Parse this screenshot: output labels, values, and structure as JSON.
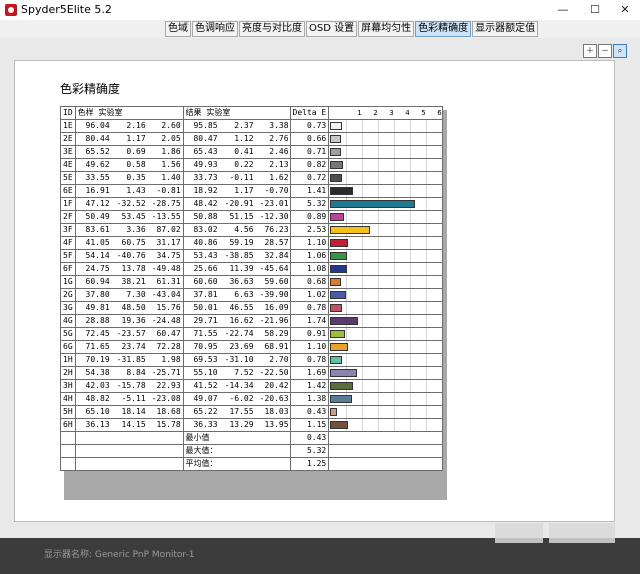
{
  "window": {
    "title": "Spyder5Elite 5.2",
    "min": "—",
    "max": "☐",
    "close": "✕"
  },
  "tabs": [
    "色域",
    "色调响应",
    "亮度与对比度",
    "OSD 设置",
    "屏幕均匀性",
    "色彩精确度",
    "显示器额定值"
  ],
  "active_tab": 5,
  "zoom_icons": [
    "zoom-in-icon",
    "zoom-out-icon",
    "zoom-fit-icon"
  ],
  "report": {
    "title": "色彩精确度"
  },
  "table": {
    "headers": {
      "id": "ID",
      "ref": "色样 实验室",
      "res": "结果 实验室",
      "de": "Delta E"
    },
    "scale": [
      "1",
      "2",
      "3",
      "4",
      "5",
      "6",
      "7"
    ],
    "rows": [
      {
        "id": "1E",
        "ref": [
          "96.04",
          "2.16",
          "2.60"
        ],
        "res": [
          "95.85",
          "2.37",
          "3.38"
        ],
        "de": "0.73",
        "color": "#f2f2f2"
      },
      {
        "id": "2E",
        "ref": [
          "80.44",
          "1.17",
          "2.05"
        ],
        "res": [
          "80.47",
          "1.12",
          "2.76"
        ],
        "de": "0.66",
        "color": "#c8c8c8"
      },
      {
        "id": "3E",
        "ref": [
          "65.52",
          "0.69",
          "1.86"
        ],
        "res": [
          "65.43",
          "0.41",
          "2.46"
        ],
        "de": "0.71",
        "color": "#a0a0a0"
      },
      {
        "id": "4E",
        "ref": [
          "49.62",
          "0.58",
          "1.56"
        ],
        "res": [
          "49.93",
          "0.22",
          "2.13"
        ],
        "de": "0.82",
        "color": "#777777"
      },
      {
        "id": "5E",
        "ref": [
          "33.55",
          "0.35",
          "1.40"
        ],
        "res": [
          "33.73",
          "-0.11",
          "1.62"
        ],
        "de": "0.72",
        "color": "#4e4e4e"
      },
      {
        "id": "6E",
        "ref": [
          "16.91",
          "1.43",
          "-0.81"
        ],
        "res": [
          "18.92",
          "1.17",
          "-0.70"
        ],
        "de": "1.41",
        "color": "#2b2b2b"
      },
      {
        "id": "1F",
        "ref": [
          "47.12",
          "-32.52",
          "-28.75"
        ],
        "res": [
          "48.42",
          "-20.91",
          "-23.01"
        ],
        "de": "5.32",
        "color": "#1e7a92"
      },
      {
        "id": "2F",
        "ref": [
          "50.49",
          "53.45",
          "-13.55"
        ],
        "res": [
          "50.88",
          "51.15",
          "-12.30"
        ],
        "de": "0.89",
        "color": "#b9449a"
      },
      {
        "id": "3F",
        "ref": [
          "83.61",
          "3.36",
          "87.02"
        ],
        "res": [
          "83.02",
          "4.56",
          "76.23"
        ],
        "de": "2.53",
        "color": "#f2c21a"
      },
      {
        "id": "4F",
        "ref": [
          "41.05",
          "60.75",
          "31.17"
        ],
        "res": [
          "40.86",
          "59.19",
          "28.57"
        ],
        "de": "1.10",
        "color": "#bf2036"
      },
      {
        "id": "5F",
        "ref": [
          "54.14",
          "-40.76",
          "34.75"
        ],
        "res": [
          "53.43",
          "-38.85",
          "32.84"
        ],
        "de": "1.06",
        "color": "#3c9449"
      },
      {
        "id": "6F",
        "ref": [
          "24.75",
          "13.78",
          "-49.48"
        ],
        "res": [
          "25.66",
          "11.39",
          "-45.64"
        ],
        "de": "1.08",
        "color": "#25368e"
      },
      {
        "id": "1G",
        "ref": [
          "60.94",
          "38.21",
          "61.31"
        ],
        "res": [
          "60.60",
          "36.63",
          "59.60"
        ],
        "de": "0.68",
        "color": "#e07a25"
      },
      {
        "id": "2G",
        "ref": [
          "37.80",
          "7.30",
          "-43.04"
        ],
        "res": [
          "37.81",
          "6.63",
          "-39.90"
        ],
        "de": "1.02",
        "color": "#4a5aa8"
      },
      {
        "id": "3G",
        "ref": [
          "49.81",
          "48.50",
          "15.76"
        ],
        "res": [
          "50.01",
          "46.55",
          "16.09"
        ],
        "de": "0.78",
        "color": "#c25461"
      },
      {
        "id": "4G",
        "ref": [
          "28.88",
          "19.36",
          "-24.48"
        ],
        "res": [
          "29.71",
          "16.62",
          "-21.96"
        ],
        "de": "1.74",
        "color": "#5b3a6e"
      },
      {
        "id": "5G",
        "ref": [
          "72.45",
          "-23.57",
          "60.47"
        ],
        "res": [
          "71.55",
          "-22.74",
          "58.29"
        ],
        "de": "0.91",
        "color": "#9ebc3c"
      },
      {
        "id": "6G",
        "ref": [
          "71.65",
          "23.74",
          "72.28"
        ],
        "res": [
          "70.95",
          "23.69",
          "68.91"
        ],
        "de": "1.10",
        "color": "#e9a22a"
      },
      {
        "id": "1H",
        "ref": [
          "70.19",
          "-31.85",
          "1.98"
        ],
        "res": [
          "69.53",
          "-31.10",
          "2.70"
        ],
        "de": "0.78",
        "color": "#63c0a8"
      },
      {
        "id": "2H",
        "ref": [
          "54.38",
          "8.84",
          "-25.71"
        ],
        "res": [
          "55.10",
          "7.52",
          "-22.50"
        ],
        "de": "1.69",
        "color": "#8a84b0"
      },
      {
        "id": "3H",
        "ref": [
          "42.03",
          "-15.78",
          "22.93"
        ],
        "res": [
          "41.52",
          "-14.34",
          "20.42"
        ],
        "de": "1.42",
        "color": "#5a6e3a"
      },
      {
        "id": "4H",
        "ref": [
          "48.82",
          "-5.11",
          "-23.08"
        ],
        "res": [
          "49.07",
          "-6.02",
          "-20.63"
        ],
        "de": "1.38",
        "color": "#5a7c96"
      },
      {
        "id": "5H",
        "ref": [
          "65.10",
          "18.14",
          "18.68"
        ],
        "res": [
          "65.22",
          "17.55",
          "18.03"
        ],
        "de": "0.43",
        "color": "#d19a86"
      },
      {
        "id": "6H",
        "ref": [
          "36.13",
          "14.15",
          "15.78"
        ],
        "res": [
          "36.33",
          "13.29",
          "13.95"
        ],
        "de": "1.15",
        "color": "#75503d"
      }
    ],
    "summary": [
      {
        "label": "最小值",
        "value": "0.43"
      },
      {
        "label": "最大值：",
        "value": "5.32"
      },
      {
        "label": "平均值：",
        "value": "1.25"
      }
    ]
  },
  "footer": {
    "monitor": "显示器名称: Generic PnP Monitor-1"
  },
  "scale_max": 7
}
